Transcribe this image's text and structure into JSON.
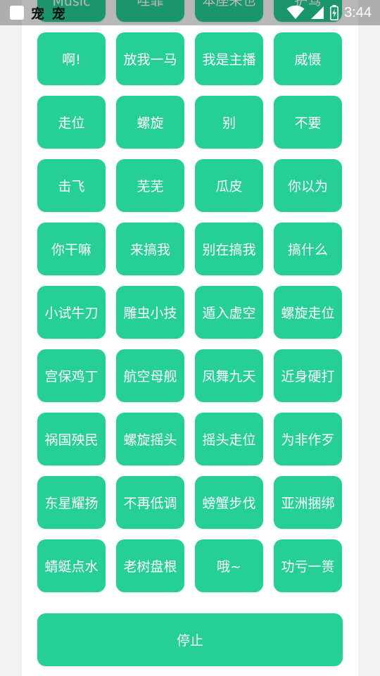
{
  "status_bar": {
    "notification_glyphs": "宠 宠",
    "time": "3:44"
  },
  "top_row_labels": [
    "Music",
    "哇靠",
    "本座来也",
    "护驾"
  ],
  "sound_buttons": [
    "啊!",
    "放我一马",
    "我是主播",
    "威慑",
    "走位",
    "螺旋",
    "别",
    "不要",
    "击飞",
    "芜芜",
    "瓜皮",
    "你以为",
    "你干嘛",
    "来搞我",
    "别在搞我",
    "搞什么",
    "小试牛刀",
    "雕虫小技",
    "遁入虚空",
    "螺旋走位",
    "宫保鸡丁",
    "航空母舰",
    "凤舞九天",
    "近身硬打",
    "祸国殃民",
    "螺旋摇头",
    "摇头走位",
    "为非作歹",
    "东星耀扬",
    "不再低调",
    "螃蟹步伐",
    "亚洲捆绑",
    "蜻蜓点水",
    "老树盘根",
    "哦~",
    "功亏一篑"
  ],
  "stop_button": "停止",
  "colors": {
    "button": "#26cf95",
    "card": "#ffffff",
    "background": "#f2f2f2"
  }
}
